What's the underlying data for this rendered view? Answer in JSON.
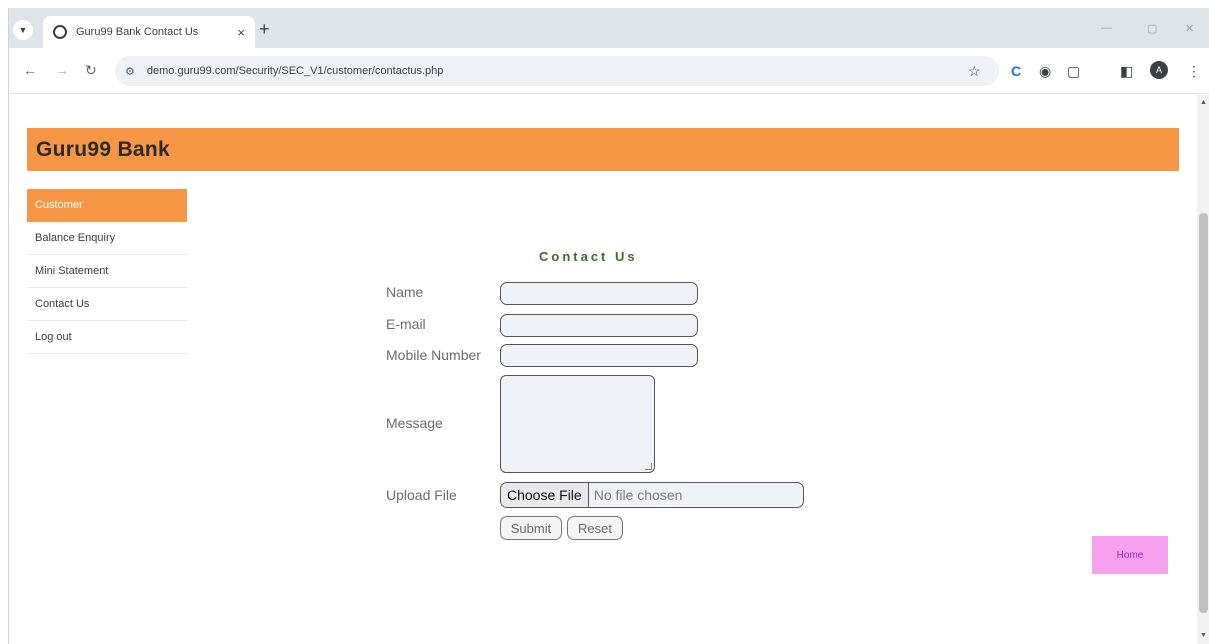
{
  "browser": {
    "tab_title": "Guru99 Bank Contact Us",
    "tab_close": "×",
    "new_tab": "+",
    "url": "demo.guru99.com/Security/SEC_V1/customer/contactus.php",
    "min": "—",
    "restore": "▢",
    "close": "✕",
    "profile_initial": "A"
  },
  "header": {
    "title": "Guru99 Bank"
  },
  "menu": {
    "items": [
      {
        "label": "Customer"
      },
      {
        "label": "Balance Enquiry"
      },
      {
        "label": "Mini Statement"
      },
      {
        "label": "Contact Us"
      },
      {
        "label": "Log out"
      }
    ]
  },
  "form": {
    "heading": "Contact Us",
    "name_label": "Name",
    "email_label": "E-mail",
    "mobile_label": "Mobile Number",
    "message_label": "Message",
    "upload_label": "Upload File",
    "choose_file": "Choose File",
    "file_status": "No file chosen",
    "submit": "Submit",
    "reset": "Reset"
  },
  "home_link": "Home",
  "colors": {
    "brand_orange": "#f79645",
    "home_pink": "#f7a1ee",
    "heading_green": "#3f6b2e"
  }
}
